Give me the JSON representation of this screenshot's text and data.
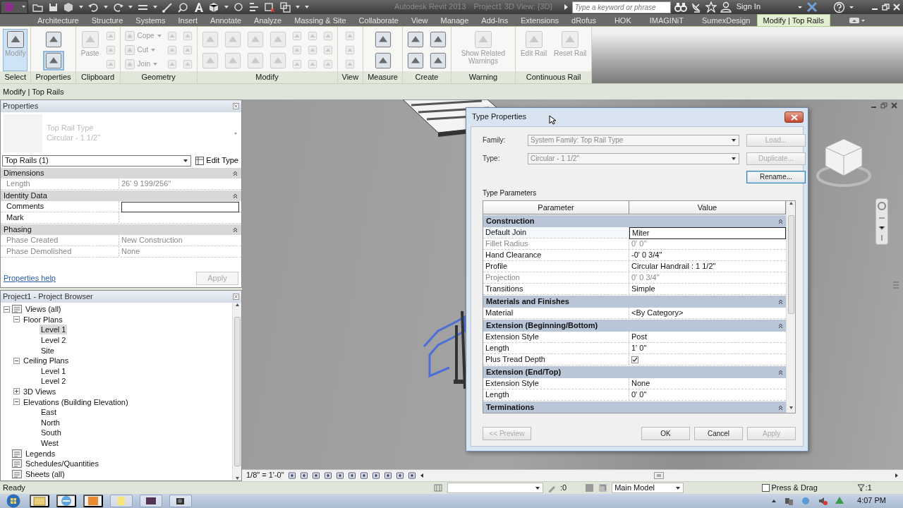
{
  "title_bar": {
    "app": "Autodesk Revit 2013",
    "document": "Project1    3D View: {3D}",
    "search": {
      "placeholder": "Type a keyword or phrase"
    },
    "sign_in": "Sign In"
  },
  "ribbon_tabs": [
    {
      "label": "Architecture",
      "selected": false
    },
    {
      "label": "Structure",
      "selected": false
    },
    {
      "label": "Systems",
      "selected": false
    },
    {
      "label": "Insert",
      "selected": false
    },
    {
      "label": "Annotate",
      "selected": false
    },
    {
      "label": "Analyze",
      "selected": false
    },
    {
      "label": "Massing & Site",
      "selected": false
    },
    {
      "label": "Collaborate",
      "selected": false
    },
    {
      "label": "View",
      "selected": false
    },
    {
      "label": "Manage",
      "selected": false
    },
    {
      "label": "Add-Ins",
      "selected": false
    },
    {
      "label": "Extensions",
      "selected": false
    },
    {
      "label": "dRofus",
      "selected": false
    },
    {
      "label": "HOK",
      "selected": false
    },
    {
      "label": "IMAGINiT",
      "selected": false
    },
    {
      "label": "SumexDesign",
      "selected": false
    },
    {
      "label": "Modify | Top Rails",
      "selected": true
    }
  ],
  "ribbon_panels": [
    {
      "label": "Select",
      "tools": [
        {
          "kind": "large",
          "label": "Modify",
          "selected": true,
          "disabled": false
        }
      ]
    },
    {
      "label": "Properties",
      "tools": [
        {
          "kind": "half",
          "selected": false,
          "disabled": false
        },
        {
          "kind": "half",
          "selected": true,
          "disabled": false
        }
      ]
    },
    {
      "label": "Clipboard",
      "tools": [
        {
          "kind": "large",
          "label": "Paste",
          "selected": false,
          "disabled": true
        },
        {
          "kind": "icon",
          "selected": false,
          "disabled": true
        },
        {
          "kind": "icon",
          "selected": false,
          "disabled": true
        },
        {
          "kind": "icon",
          "selected": false,
          "disabled": true
        }
      ]
    },
    {
      "label": "Geometry",
      "tools": [
        {
          "kind": "small",
          "label": "Cope",
          "selected": false,
          "disabled": true
        },
        {
          "kind": "small",
          "label": "Cut",
          "selected": false,
          "disabled": true
        },
        {
          "kind": "small",
          "label": "Join",
          "selected": false,
          "disabled": true
        },
        {
          "kind": "icon",
          "selected": false,
          "disabled": true
        },
        {
          "kind": "icon",
          "selected": false,
          "disabled": true
        },
        {
          "kind": "icon",
          "selected": false,
          "disabled": true
        },
        {
          "kind": "icon",
          "selected": false,
          "disabled": true
        },
        {
          "kind": "icon",
          "selected": false,
          "disabled": true
        },
        {
          "kind": "icon",
          "selected": false,
          "disabled": true
        }
      ]
    },
    {
      "label": "Modify",
      "tools": [
        {
          "kind": "half",
          "selected": false,
          "disabled": true
        },
        {
          "kind": "half",
          "selected": false,
          "disabled": true
        },
        {
          "kind": "half",
          "selected": false,
          "disabled": true
        },
        {
          "kind": "half",
          "selected": false,
          "disabled": true
        },
        {
          "kind": "half",
          "selected": false,
          "disabled": true
        },
        {
          "kind": "half",
          "selected": false,
          "disabled": true
        },
        {
          "kind": "half",
          "selected": false,
          "disabled": true
        },
        {
          "kind": "half",
          "selected": false,
          "disabled": true
        },
        {
          "kind": "icon",
          "selected": false,
          "disabled": true
        },
        {
          "kind": "icon",
          "selected": false,
          "disabled": true
        },
        {
          "kind": "icon",
          "selected": false,
          "disabled": true
        },
        {
          "kind": "icon",
          "selected": false,
          "disabled": true
        },
        {
          "kind": "icon",
          "selected": false,
          "disabled": true
        },
        {
          "kind": "icon",
          "selected": false,
          "disabled": true
        },
        {
          "kind": "icon",
          "selected": false,
          "disabled": true
        },
        {
          "kind": "icon",
          "selected": false,
          "disabled": true
        },
        {
          "kind": "icon",
          "selected": false,
          "disabled": true
        }
      ]
    },
    {
      "label": "View",
      "tools": [
        {
          "kind": "icon",
          "selected": false,
          "disabled": true
        },
        {
          "kind": "icon",
          "selected": false,
          "disabled": true
        },
        {
          "kind": "icon",
          "selected": false,
          "disabled": true
        }
      ]
    },
    {
      "label": "Measure",
      "tools": [
        {
          "kind": "half",
          "selected": false,
          "disabled": false
        },
        {
          "kind": "half",
          "selected": false,
          "disabled": false
        }
      ]
    },
    {
      "label": "Create",
      "tools": [
        {
          "kind": "half",
          "selected": false,
          "disabled": false
        },
        {
          "kind": "half",
          "selected": false,
          "disabled": false
        },
        {
          "kind": "half",
          "selected": false,
          "disabled": false
        },
        {
          "kind": "half",
          "selected": false,
          "disabled": false
        }
      ]
    },
    {
      "label": "Warning",
      "tools": [
        {
          "kind": "large",
          "label": "Show Related Warnings",
          "selected": false,
          "disabled": true
        }
      ]
    },
    {
      "label": "Continuous Rail",
      "tools": [
        {
          "kind": "large",
          "label": "Edit Rail",
          "selected": false,
          "disabled": true
        },
        {
          "kind": "large",
          "label": "Reset Rail",
          "selected": false,
          "disabled": true
        }
      ]
    }
  ],
  "options_bar": "Modify | Top Rails",
  "properties": {
    "title": "Properties",
    "type_family": "Top Rail Type",
    "type_name": "Circular - 1 1/2\"",
    "instance": "Top Rails (1)",
    "edit_type": "Edit Type",
    "groups": [
      {
        "name": "Dimensions",
        "rows": [
          {
            "label": "Length",
            "value": "26'  9 199/256\"",
            "disabled": true,
            "focused": false
          }
        ]
      },
      {
        "name": "Identity Data",
        "rows": [
          {
            "label": "Comments",
            "disabled": false,
            "focused": true
          },
          {
            "label": "Mark",
            "disabled": false,
            "focused": false
          }
        ]
      },
      {
        "name": "Phasing",
        "rows": [
          {
            "label": "Phase Created",
            "value": "New Construction",
            "disabled": true,
            "focused": false
          },
          {
            "label": "Phase Demolished",
            "value": "None",
            "disabled": true,
            "focused": false
          }
        ]
      }
    ],
    "help": "Properties help",
    "apply": {
      "label": "Apply",
      "disabled": true
    }
  },
  "browser": {
    "title": "Project1 - Project Browser",
    "tree": [
      {
        "label": "Views (all)",
        "expanded": true,
        "selected": false,
        "children": [
          {
            "label": "Floor Plans",
            "expanded": true,
            "selected": false,
            "children": [
              {
                "label": "Level 1",
                "selected": true
              },
              {
                "label": "Level 2",
                "selected": false
              },
              {
                "label": "Site",
                "selected": false
              }
            ]
          },
          {
            "label": "Ceiling Plans",
            "expanded": true,
            "selected": false,
            "children": [
              {
                "label": "Level 1",
                "selected": false
              },
              {
                "label": "Level 2",
                "selected": false
              }
            ]
          },
          {
            "label": "3D Views",
            "expanded": false,
            "selected": false
          },
          {
            "label": "Elevations (Building Elevation)",
            "expanded": true,
            "selected": false,
            "children": [
              {
                "label": "East",
                "selected": false
              },
              {
                "label": "North",
                "selected": false
              },
              {
                "label": "South",
                "selected": false
              },
              {
                "label": "West",
                "selected": false
              }
            ]
          }
        ]
      },
      {
        "label": "Legends",
        "selected": false
      },
      {
        "label": "Schedules/Quantities",
        "selected": false
      },
      {
        "label": "Sheets (all)",
        "selected": false
      }
    ]
  },
  "type_properties": {
    "title": "Type Properties",
    "family_label": "Family:",
    "family": "System Family: Top Rail Type",
    "type_label": "Type:",
    "type": "Circular - 1 1/2\"",
    "side_buttons": [
      {
        "label": "Load...",
        "disabled": true,
        "focused": false
      },
      {
        "label": "Duplicate...",
        "disabled": true,
        "focused": false
      },
      {
        "label": "Rename...",
        "disabled": false,
        "focused": true
      }
    ],
    "section": "Type Parameters",
    "columns": [
      "Parameter",
      "Value"
    ],
    "groups": [
      {
        "name": "Construction",
        "rows": [
          {
            "kind": "text",
            "label": "Default Join",
            "value": "Miter",
            "disabled": false,
            "focused": true
          },
          {
            "kind": "text",
            "label": "Fillet Radius",
            "value": "0'  0\"",
            "disabled": true,
            "focused": false
          },
          {
            "kind": "text",
            "label": "Hand Clearance",
            "value": "-0'  0 3/4\"",
            "disabled": false,
            "focused": false
          },
          {
            "kind": "text",
            "label": "Profile",
            "value": "Circular Handrail : 1 1/2\"",
            "disabled": false,
            "focused": false
          },
          {
            "kind": "text",
            "label": "Projection",
            "value": "0'  0 3/4\"",
            "disabled": true,
            "focused": false
          },
          {
            "kind": "text",
            "label": "Transitions",
            "value": "Simple",
            "disabled": false,
            "focused": false
          }
        ]
      },
      {
        "name": "Materials and Finishes",
        "rows": [
          {
            "kind": "text",
            "label": "Material",
            "value": "<By Category>",
            "disabled": false,
            "focused": false
          }
        ]
      },
      {
        "name": "Extension (Beginning/Bottom)",
        "rows": [
          {
            "kind": "text",
            "label": "Extension Style",
            "value": "Post",
            "disabled": false,
            "focused": false
          },
          {
            "kind": "text",
            "label": "Length",
            "value": "1'  0\"",
            "disabled": false,
            "focused": false
          },
          {
            "kind": "checkbox",
            "label": "Plus Tread Depth",
            "checked": true,
            "disabled": false,
            "focused": false
          }
        ]
      },
      {
        "name": "Extension (End/Top)",
        "rows": [
          {
            "kind": "text",
            "label": "Extension Style",
            "value": "None",
            "disabled": false,
            "focused": false
          },
          {
            "kind": "text",
            "label": "Length",
            "value": "0'  0\"",
            "disabled": false,
            "focused": false
          }
        ]
      },
      {
        "name": "Terminations"
      }
    ],
    "buttons": [
      {
        "label": "<< Preview",
        "disabled": true
      },
      {
        "label": "OK",
        "disabled": false
      },
      {
        "label": "Cancel",
        "disabled": false
      },
      {
        "label": "Apply",
        "disabled": true
      }
    ]
  },
  "view_bar": {
    "scale": "1/8\" = 1'-0\""
  },
  "status_bar": {
    "status": "Ready",
    "count": ":0",
    "model": "Main Model",
    "press_drag": {
      "label": "Press & Drag",
      "checked": false
    },
    "filter": ":1"
  },
  "taskbar": {
    "time": "4:07 PM"
  }
}
